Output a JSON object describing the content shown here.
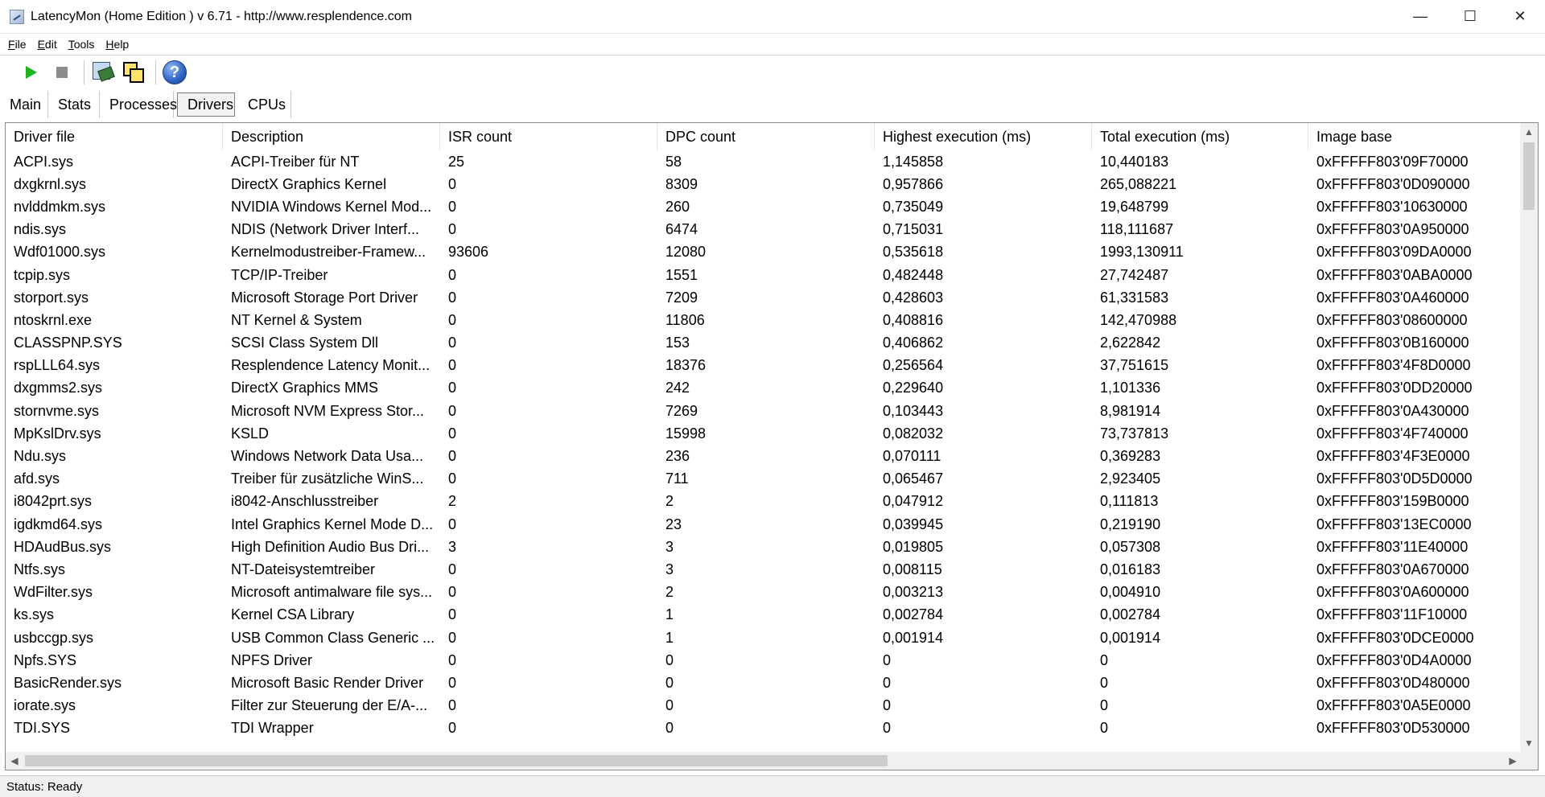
{
  "window": {
    "title": "LatencyMon  (Home Edition )  v 6.71 - http://www.resplendence.com",
    "minimize": "—",
    "maximize": "☐",
    "close": "✕"
  },
  "menu": [
    {
      "label": "File"
    },
    {
      "label": "Edit"
    },
    {
      "label": "Tools"
    },
    {
      "label": "Help"
    }
  ],
  "toolbar": {
    "icons": [
      "play-icon",
      "stop-icon",
      "drivers-tool-icon",
      "windows-tool-icon",
      "help-icon"
    ],
    "help_glyph": "?"
  },
  "tabs": [
    {
      "label": "Main",
      "active": false
    },
    {
      "label": "Stats",
      "active": false
    },
    {
      "label": "Processes",
      "active": false
    },
    {
      "label": "Drivers",
      "active": true
    },
    {
      "label": "CPUs",
      "active": false
    }
  ],
  "table": {
    "columns": [
      "Driver file",
      "Description",
      "ISR count",
      "DPC count",
      "Highest execution (ms)",
      "Total execution (ms)",
      "Image base"
    ],
    "rows": [
      [
        "ACPI.sys",
        "ACPI-Treiber für NT",
        "25",
        "58",
        "1,145858",
        "10,440183",
        "0xFFFFF803'09F70000"
      ],
      [
        "dxgkrnl.sys",
        "DirectX Graphics Kernel",
        "0",
        "8309",
        "0,957866",
        "265,088221",
        "0xFFFFF803'0D090000"
      ],
      [
        "nvlddmkm.sys",
        "NVIDIA Windows Kernel Mod...",
        "0",
        "260",
        "0,735049",
        "19,648799",
        "0xFFFFF803'10630000"
      ],
      [
        "ndis.sys",
        "NDIS (Network Driver Interf...",
        "0",
        "6474",
        "0,715031",
        "118,111687",
        "0xFFFFF803'0A950000"
      ],
      [
        "Wdf01000.sys",
        "Kernelmodustreiber-Framew...",
        "93606",
        "12080",
        "0,535618",
        "1993,130911",
        "0xFFFFF803'09DA0000"
      ],
      [
        "tcpip.sys",
        "TCP/IP-Treiber",
        "0",
        "1551",
        "0,482448",
        "27,742487",
        "0xFFFFF803'0ABA0000"
      ],
      [
        "storport.sys",
        "Microsoft Storage Port Driver",
        "0",
        "7209",
        "0,428603",
        "61,331583",
        "0xFFFFF803'0A460000"
      ],
      [
        "ntoskrnl.exe",
        "NT Kernel & System",
        "0",
        "11806",
        "0,408816",
        "142,470988",
        "0xFFFFF803'08600000"
      ],
      [
        "CLASSPNP.SYS",
        "SCSI Class System Dll",
        "0",
        "153",
        "0,406862",
        "2,622842",
        "0xFFFFF803'0B160000"
      ],
      [
        "rspLLL64.sys",
        "Resplendence Latency Monit...",
        "0",
        "18376",
        "0,256564",
        "37,751615",
        "0xFFFFF803'4F8D0000"
      ],
      [
        "dxgmms2.sys",
        "DirectX Graphics MMS",
        "0",
        "242",
        "0,229640",
        "1,101336",
        "0xFFFFF803'0DD20000"
      ],
      [
        "stornvme.sys",
        "Microsoft NVM Express Stor...",
        "0",
        "7269",
        "0,103443",
        "8,981914",
        "0xFFFFF803'0A430000"
      ],
      [
        "MpKslDrv.sys",
        "KSLD",
        "0",
        "15998",
        "0,082032",
        "73,737813",
        "0xFFFFF803'4F740000"
      ],
      [
        "Ndu.sys",
        "Windows Network Data Usa...",
        "0",
        "236",
        "0,070111",
        "0,369283",
        "0xFFFFF803'4F3E0000"
      ],
      [
        "afd.sys",
        "Treiber für zusätzliche WinS...",
        "0",
        "711",
        "0,065467",
        "2,923405",
        "0xFFFFF803'0D5D0000"
      ],
      [
        "i8042prt.sys",
        "i8042-Anschlusstreiber",
        "2",
        "2",
        "0,047912",
        "0,111813",
        "0xFFFFF803'159B0000"
      ],
      [
        "igdkmd64.sys",
        "Intel Graphics Kernel Mode D...",
        "0",
        "23",
        "0,039945",
        "0,219190",
        "0xFFFFF803'13EC0000"
      ],
      [
        "HDAudBus.sys",
        "High Definition Audio Bus Dri...",
        "3",
        "3",
        "0,019805",
        "0,057308",
        "0xFFFFF803'11E40000"
      ],
      [
        "Ntfs.sys",
        "NT-Dateisystemtreiber",
        "0",
        "3",
        "0,008115",
        "0,016183",
        "0xFFFFF803'0A670000"
      ],
      [
        "WdFilter.sys",
        "Microsoft antimalware file sys...",
        "0",
        "2",
        "0,003213",
        "0,004910",
        "0xFFFFF803'0A600000"
      ],
      [
        "ks.sys",
        "Kernel CSA Library",
        "0",
        "1",
        "0,002784",
        "0,002784",
        "0xFFFFF803'11F10000"
      ],
      [
        "usbccgp.sys",
        "USB Common Class Generic ...",
        "0",
        "1",
        "0,001914",
        "0,001914",
        "0xFFFFF803'0DCE0000"
      ],
      [
        "Npfs.SYS",
        "NPFS Driver",
        "0",
        "0",
        "0",
        "0",
        "0xFFFFF803'0D4A0000"
      ],
      [
        "BasicRender.sys",
        "Microsoft Basic Render Driver",
        "0",
        "0",
        "0",
        "0",
        "0xFFFFF803'0D480000"
      ],
      [
        "iorate.sys",
        "Filter zur Steuerung der E/A-...",
        "0",
        "0",
        "0",
        "0",
        "0xFFFFF803'0A5E0000"
      ],
      [
        "TDI.SYS",
        "TDI Wrapper",
        "0",
        "0",
        "0",
        "0",
        "0xFFFFF803'0D530000"
      ]
    ]
  },
  "scrollbars": {
    "up": "▲",
    "down": "▼",
    "left": "◀",
    "right": "▶"
  },
  "status": "Status: Ready"
}
